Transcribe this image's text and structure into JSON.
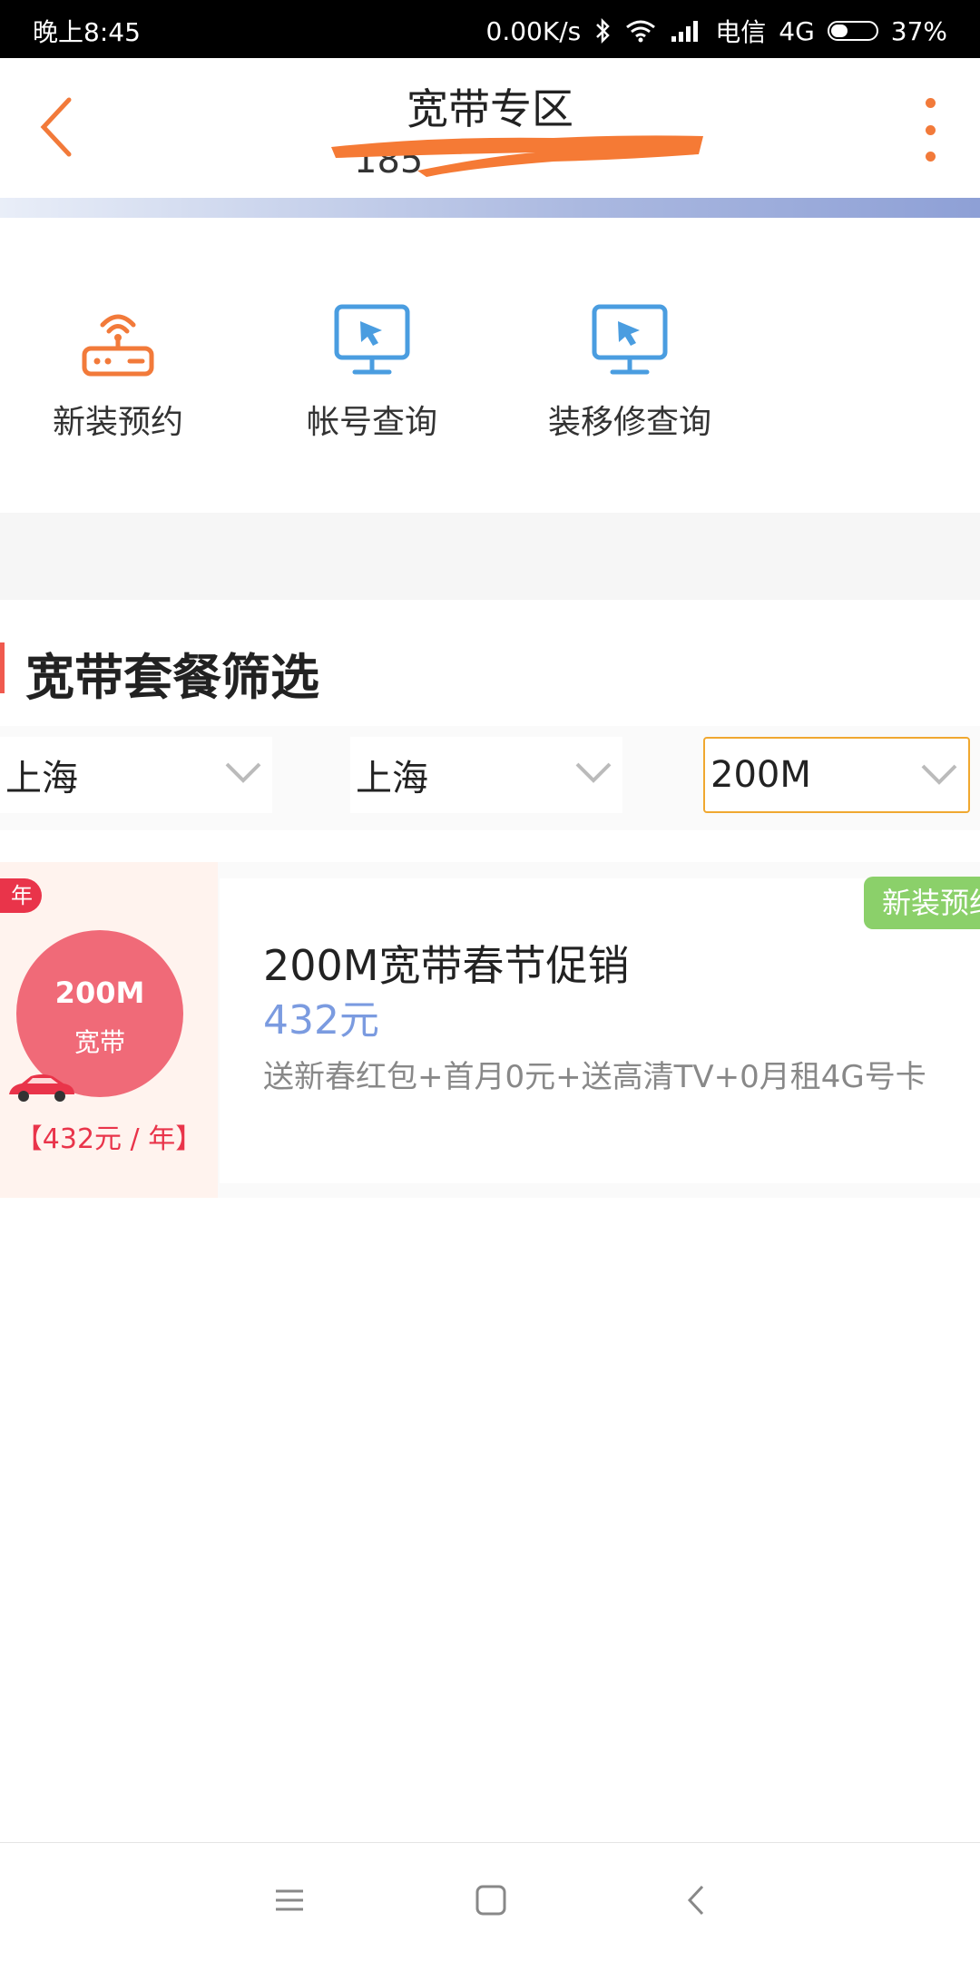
{
  "status_bar": {
    "time": "晚上8:45",
    "speed": "0.00K/s",
    "carrier": "电信",
    "network": "4G",
    "battery": "37%",
    "battery_level": 0.37
  },
  "header": {
    "title": "宽带专区",
    "subtitle_partial": "185",
    "accent_color": "#f27a3a"
  },
  "quick_actions": [
    {
      "label": "新装预约",
      "icon": "router-icon",
      "color": "#f27a3a"
    },
    {
      "label": "帐号查询",
      "icon": "monitor-icon",
      "color": "#4a9de0"
    },
    {
      "label": "装移修查询",
      "icon": "monitor-icon",
      "color": "#4a9de0"
    }
  ],
  "section": {
    "title": "宽带套餐筛选"
  },
  "filters": [
    {
      "value": "上海"
    },
    {
      "value": "上海"
    },
    {
      "value": "200M",
      "active": true
    }
  ],
  "product": {
    "ribbon": "年",
    "badge_speed": "200M",
    "badge_type": "宽带",
    "badge_price": "【432元 / 年】",
    "tag": "新装预约",
    "name": "200M宽带春节促销",
    "price": "432元",
    "description": "送新春红包+首月0元+送高清TV+0月租4G号卡"
  },
  "nav": {
    "menu": "menu-icon",
    "home": "home-icon",
    "back": "back-icon"
  }
}
